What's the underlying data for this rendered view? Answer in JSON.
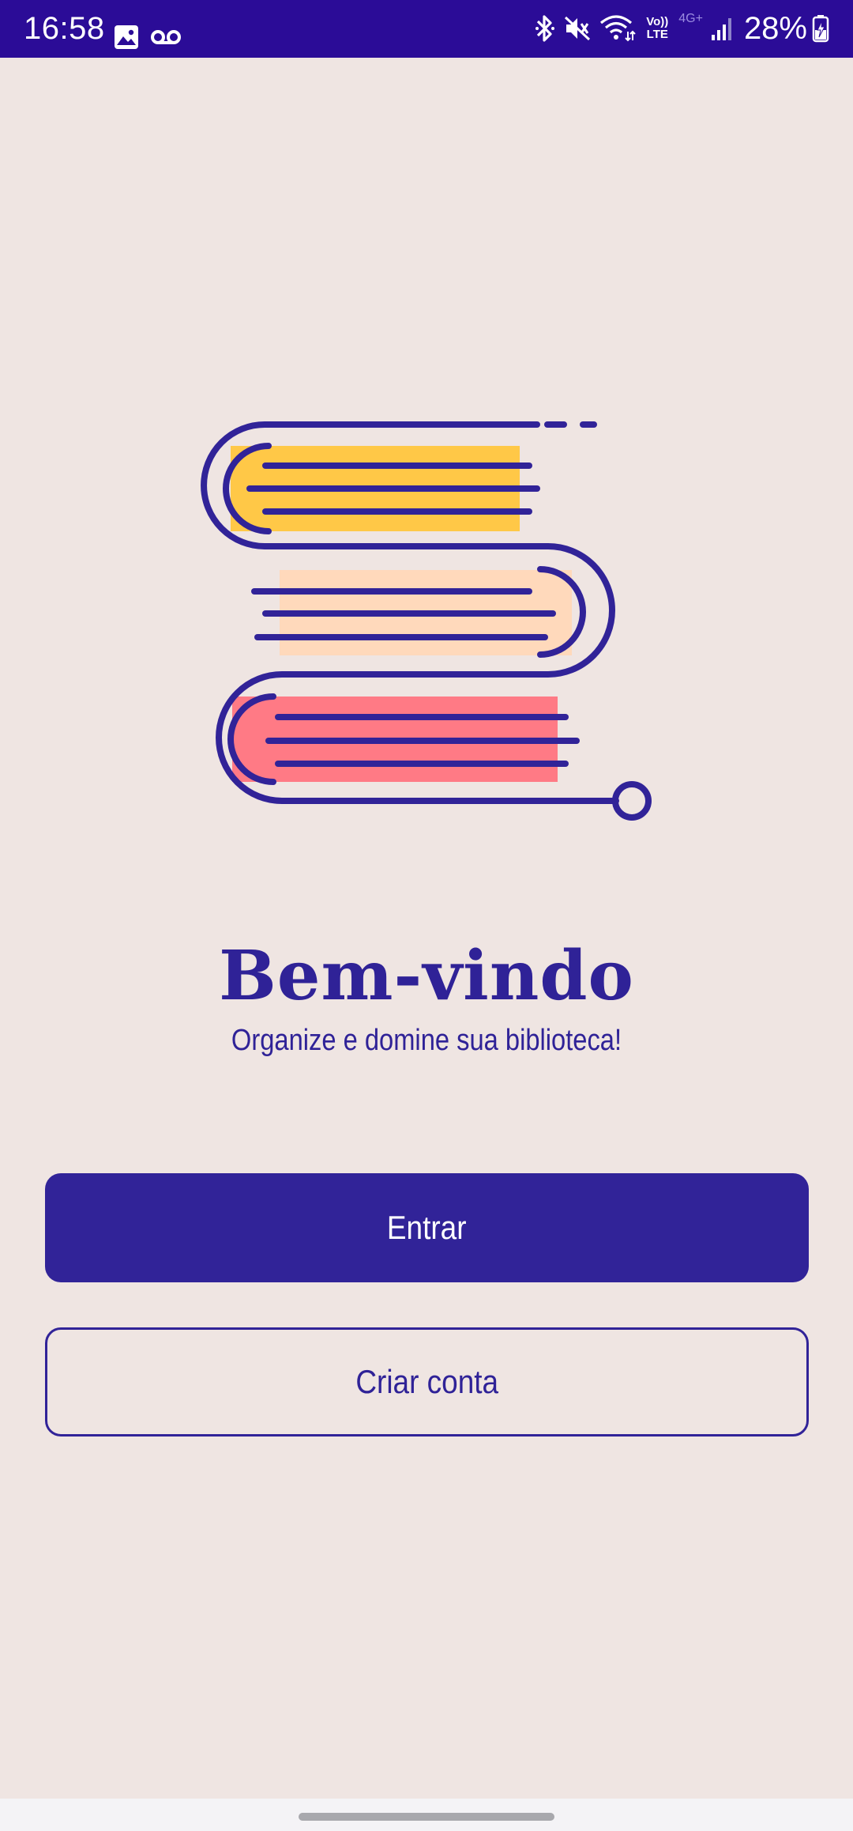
{
  "status_bar": {
    "time": "16:58",
    "battery_percent": "28%",
    "volte_top": "Vo))",
    "volte_bottom": "LTE",
    "network_type": "4G+",
    "background_color": "#2b0c97",
    "icons": [
      "image-icon",
      "voicemail-icon",
      "bluetooth-icon",
      "mute-icon",
      "wifi-icon",
      "volte-icon",
      "signal-icon",
      "battery-charging-icon"
    ]
  },
  "welcome": {
    "title": "Bem-vindo",
    "subtitle": "Organize e domine sua biblioteca!"
  },
  "actions": {
    "login_label": "Entrar",
    "signup_label": "Criar conta"
  },
  "colors": {
    "background": "#efe5e2",
    "primary": "#312398",
    "book_yellow": "#ffc847",
    "book_peach": "#ffd9bb",
    "book_pink": "#ff7a85"
  }
}
